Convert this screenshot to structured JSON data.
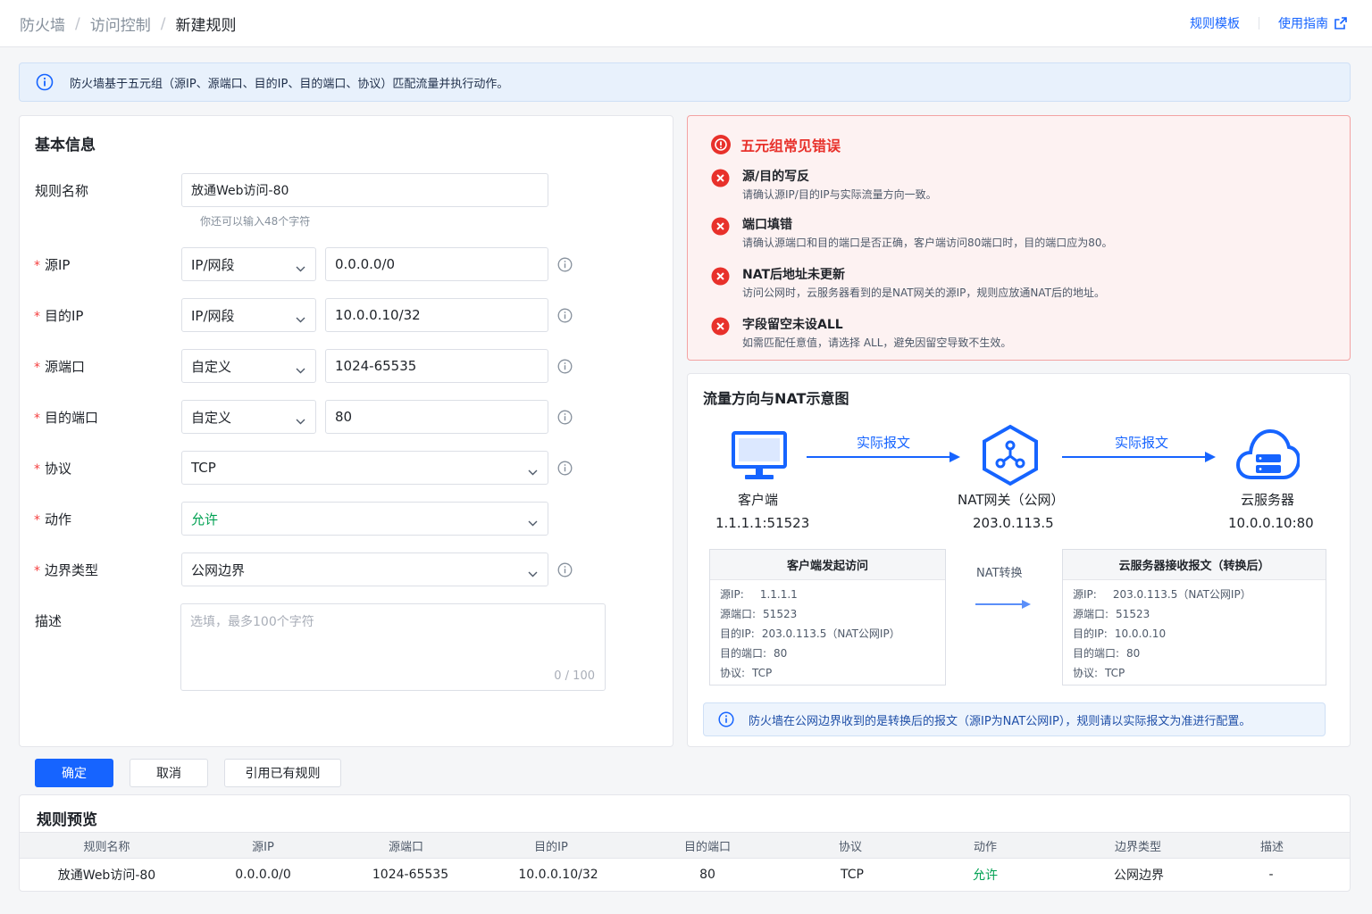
{
  "breadcrumb": {
    "items": [
      "防火墙",
      "访问控制"
    ],
    "current": "新建规则",
    "separator": "/"
  },
  "header_links": {
    "template": "规则模板",
    "guide": "使用指南"
  },
  "banner": {
    "text": "防火墙基于五元组（源IP、源端口、目的IP、目的端口、协议）匹配流量并执行动作。"
  },
  "form": {
    "title": "基本信息",
    "rule_name": {
      "label": "规则名称",
      "value": "放通Web访问-80",
      "hint": "你还可以输入48个字符"
    },
    "src_ip": {
      "label": "源IP",
      "type": "IP/网段",
      "value": "0.0.0.0/0"
    },
    "dst_ip": {
      "label": "目的IP",
      "type": "IP/网段",
      "value": "10.0.0.10/32"
    },
    "src_port": {
      "label": "源端口",
      "type": "自定义",
      "value": "1024-65535"
    },
    "dst_port": {
      "label": "目的端口",
      "type": "自定义",
      "value": "80"
    },
    "protocol": {
      "label": "协议",
      "value": "TCP"
    },
    "action": {
      "label": "动作",
      "value": "允许"
    },
    "boundary": {
      "label": "边界类型",
      "value": "公网边界"
    },
    "description": {
      "label": "描述",
      "placeholder": "选填，最多100个字符",
      "counter": "0 / 100"
    },
    "required_mark": "*"
  },
  "buttons": {
    "confirm": "确定",
    "cancel": "取消",
    "import": "引用已有规则"
  },
  "errors": {
    "title": "五元组常见错误",
    "items": [
      {
        "title": "源/目的写反",
        "desc": "请确认源IP/目的IP与实际流量方向一致。"
      },
      {
        "title": "端口填错",
        "desc": "请确认源端口和目的端口是否正确，客户端访问80端口时，目的端口应为80。"
      },
      {
        "title": "NAT后地址未更新",
        "desc": "访问公网时，云服务器看到的是NAT网关的源IP，规则应放通NAT后的地址。"
      },
      {
        "title": "字段留空未设ALL",
        "desc": "如需匹配任意值，请选择 ALL，避免因留空导致不生效。"
      }
    ]
  },
  "diagram": {
    "title": "流量方向与NAT示意图",
    "client": {
      "label": "客户端",
      "ip": "1.1.1.1:51523"
    },
    "nat": {
      "label": "NAT网关（公网）",
      "ip": "203.0.113.5"
    },
    "server": {
      "label": "云服务器",
      "ip": "10.0.0.10:80"
    },
    "arrow1_label": "实际报文",
    "arrow2_label": "实际报文",
    "nat_convert_label": "NAT转换",
    "packet_before": {
      "title": "客户端发起访问",
      "rows": [
        {
          "k": "源IP:",
          "v": "1.1.1.1"
        },
        {
          "k": "源端口:",
          "v": "51523"
        },
        {
          "k": "目的IP:",
          "v": "203.0.113.5（NAT公网IP）"
        },
        {
          "k": "目的端口:",
          "v": "80"
        },
        {
          "k": "协议:",
          "v": "TCP"
        }
      ]
    },
    "packet_after": {
      "title": "云服务器接收报文（转换后）",
      "rows": [
        {
          "k": "源IP:",
          "v": "203.0.113.5（NAT公网IP）"
        },
        {
          "k": "源端口:",
          "v": "51523"
        },
        {
          "k": "目的IP:",
          "v": "10.0.0.10"
        },
        {
          "k": "目的端口:",
          "v": "80"
        },
        {
          "k": "协议:",
          "v": "TCP"
        }
      ]
    },
    "note": "防火墙在公网边界收到的是转换后的报文（源IP为NAT公网IP），规则请以实际报文为准进行配置。"
  },
  "preview": {
    "title": "规则预览",
    "columns": [
      "规则名称",
      "源IP",
      "源端口",
      "目的IP",
      "目的端口",
      "协议",
      "动作",
      "边界类型",
      "描述"
    ],
    "row": [
      "放通Web访问-80",
      "0.0.0.0/0",
      "1024-65535",
      "10.0.0.10/32",
      "80",
      "TCP",
      "允许",
      "公网边界",
      "-"
    ]
  },
  "colors": {
    "primary": "#1664ff",
    "danger": "#e8312b",
    "success": "#00a152",
    "info_bg": "#e8f1fc"
  }
}
